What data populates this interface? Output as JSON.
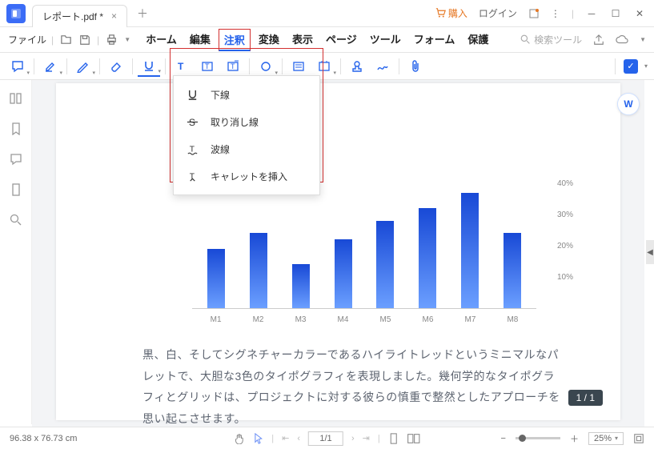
{
  "titlebar": {
    "doc_name": "レポート.pdf *",
    "buy_label": "購入",
    "login_label": "ログイン"
  },
  "menubar": {
    "file_label": "ファイル",
    "items": [
      "ホーム",
      "編集",
      "注釈",
      "変換",
      "表示",
      "ページ",
      "ツール",
      "フォーム",
      "保護"
    ],
    "active_index": 2,
    "search_placeholder": "検索ツール"
  },
  "dropdown": {
    "items": [
      {
        "label": "下線",
        "icon": "underline-icon"
      },
      {
        "label": "取り消し線",
        "icon": "strikethrough-icon"
      },
      {
        "label": "波線",
        "icon": "squiggly-icon"
      },
      {
        "label": "キャレットを挿入",
        "icon": "caret-insert-icon"
      }
    ]
  },
  "chart_data": {
    "type": "bar",
    "categories": [
      "M1",
      "M2",
      "M3",
      "M4",
      "M5",
      "M6",
      "M7",
      "M8"
    ],
    "values": [
      19,
      24,
      14,
      22,
      28,
      32,
      37,
      24
    ],
    "yticks": [
      10,
      20,
      30,
      40
    ],
    "ytick_labels": [
      "10%",
      "20%",
      "30%",
      "40%"
    ],
    "ylim": [
      0,
      40
    ]
  },
  "body_text": "黒、白、そしてシグネチャーカラーであるハイライトレッドというミニマルなパレットで、大胆な3色のタイポグラフィを表現しました。幾何学的なタイポグラフィとグリッドは、プロジェクトに対する彼らの慎重で整然としたアプローチを思い起こさせます。",
  "page_indicator": "1 / 1",
  "statusbar": {
    "dimensions": "96.38 x 76.73 cm",
    "page_current": "1",
    "page_total": "1",
    "zoom": "25%"
  }
}
